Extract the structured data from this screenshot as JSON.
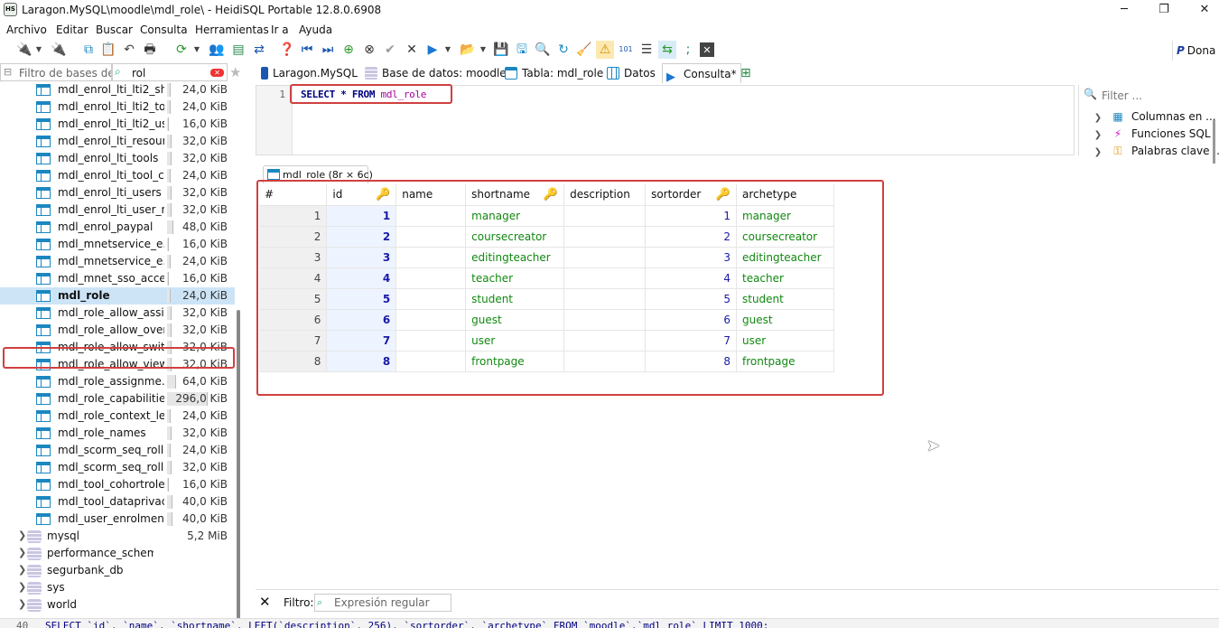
{
  "window": {
    "app_icon_text": "HS",
    "title": "Laragon.MySQL\\moodle\\mdl_role\\ - HeidiSQL Portable 12.8.0.6908",
    "minimize": "─",
    "maximize": "❐",
    "close": "✕"
  },
  "menu": [
    "Archivo",
    "Editar",
    "Buscar",
    "Consulta",
    "Herramientas",
    "Ir a",
    "Ayuda"
  ],
  "toolbar": {
    "donate_label": "Dona"
  },
  "sidebar": {
    "db_filter_placeholder": "Filtro de bases de d",
    "table_filter_value": "rol",
    "tables": [
      {
        "name": "mdl_enrol_lti_lti2_sh...",
        "size": "24,0 KiB",
        "fill": 0.08
      },
      {
        "name": "mdl_enrol_lti_lti2_to...",
        "size": "24,0 KiB",
        "fill": 0.08
      },
      {
        "name": "mdl_enrol_lti_lti2_us...",
        "size": "16,0 KiB",
        "fill": 0.05
      },
      {
        "name": "mdl_enrol_lti_resour...",
        "size": "32,0 KiB",
        "fill": 0.11
      },
      {
        "name": "mdl_enrol_lti_tools",
        "size": "32,0 KiB",
        "fill": 0.11
      },
      {
        "name": "mdl_enrol_lti_tool_c...",
        "size": "24,0 KiB",
        "fill": 0.08
      },
      {
        "name": "mdl_enrol_lti_users",
        "size": "32,0 KiB",
        "fill": 0.11
      },
      {
        "name": "mdl_enrol_lti_user_r...",
        "size": "32,0 KiB",
        "fill": 0.11
      },
      {
        "name": "mdl_enrol_paypal",
        "size": "48,0 KiB",
        "fill": 0.16
      },
      {
        "name": "mdl_mnetservice_e...",
        "size": "16,0 KiB",
        "fill": 0.05
      },
      {
        "name": "mdl_mnetservice_e...",
        "size": "24,0 KiB",
        "fill": 0.08
      },
      {
        "name": "mdl_mnet_sso_acce...",
        "size": "16,0 KiB",
        "fill": 0.05
      },
      {
        "name": "mdl_role",
        "size": "24,0 KiB",
        "fill": 0.08,
        "selected": true
      },
      {
        "name": "mdl_role_allow_assi...",
        "size": "32,0 KiB",
        "fill": 0.11
      },
      {
        "name": "mdl_role_allow_over...",
        "size": "32,0 KiB",
        "fill": 0.11
      },
      {
        "name": "mdl_role_allow_swit...",
        "size": "32,0 KiB",
        "fill": 0.11
      },
      {
        "name": "mdl_role_allow_view",
        "size": "32,0 KiB",
        "fill": 0.11
      },
      {
        "name": "mdl_role_assignme...",
        "size": "64,0 KiB",
        "fill": 0.22
      },
      {
        "name": "mdl_role_capabilities",
        "size": "296,0 KiB",
        "fill": 1.0
      },
      {
        "name": "mdl_role_context_le...",
        "size": "24,0 KiB",
        "fill": 0.08
      },
      {
        "name": "mdl_role_names",
        "size": "32,0 KiB",
        "fill": 0.11
      },
      {
        "name": "mdl_scorm_seq_roll...",
        "size": "24,0 KiB",
        "fill": 0.08
      },
      {
        "name": "mdl_scorm_seq_roll...",
        "size": "32,0 KiB",
        "fill": 0.11
      },
      {
        "name": "mdl_tool_cohortroles",
        "size": "16,0 KiB",
        "fill": 0.05
      },
      {
        "name": "mdl_tool_dataprivac...",
        "size": "40,0 KiB",
        "fill": 0.14
      },
      {
        "name": "mdl_user_enrolments",
        "size": "40,0 KiB",
        "fill": 0.14
      }
    ],
    "databases": [
      {
        "name": "mysql",
        "size": "5,2 MiB"
      },
      {
        "name": "performance_schema",
        "size": ""
      },
      {
        "name": "segurbank_db",
        "size": ""
      },
      {
        "name": "sys",
        "size": ""
      },
      {
        "name": "world",
        "size": ""
      }
    ]
  },
  "tabs": [
    {
      "label": "Laragon.MySQL"
    },
    {
      "label": "Base de datos: moodle"
    },
    {
      "label": "Tabla: mdl_role"
    },
    {
      "label": "Datos"
    },
    {
      "label": "Consulta*"
    }
  ],
  "editor": {
    "line_number": "1",
    "sql_select": "SELECT",
    "sql_star": " * ",
    "sql_from": "FROM",
    "sql_table": " mdl_role"
  },
  "help_panel": {
    "filter_placeholder": "Filter ...",
    "items": [
      "Columnas en ...",
      "Funciones SQL",
      "Palabras clave ..."
    ]
  },
  "result": {
    "tab_label": "mdl_role (8r × 6c)",
    "columns": [
      "#",
      "id",
      "name",
      "shortname",
      "description",
      "sortorder",
      "archetype"
    ],
    "rows": [
      {
        "n": "1",
        "id": "1",
        "name": "",
        "shortname": "manager",
        "description": "",
        "sortorder": "1",
        "archetype": "manager"
      },
      {
        "n": "2",
        "id": "2",
        "name": "",
        "shortname": "coursecreator",
        "description": "",
        "sortorder": "2",
        "archetype": "coursecreator"
      },
      {
        "n": "3",
        "id": "3",
        "name": "",
        "shortname": "editingteacher",
        "description": "",
        "sortorder": "3",
        "archetype": "editingteacher"
      },
      {
        "n": "4",
        "id": "4",
        "name": "",
        "shortname": "teacher",
        "description": "",
        "sortorder": "4",
        "archetype": "teacher"
      },
      {
        "n": "5",
        "id": "5",
        "name": "",
        "shortname": "student",
        "description": "",
        "sortorder": "5",
        "archetype": "student"
      },
      {
        "n": "6",
        "id": "6",
        "name": "",
        "shortname": "guest",
        "description": "",
        "sortorder": "6",
        "archetype": "guest"
      },
      {
        "n": "7",
        "id": "7",
        "name": "",
        "shortname": "user",
        "description": "",
        "sortorder": "7",
        "archetype": "user"
      },
      {
        "n": "8",
        "id": "8",
        "name": "",
        "shortname": "frontpage",
        "description": "",
        "sortorder": "8",
        "archetype": "frontpage"
      }
    ]
  },
  "filter_bar": {
    "label": "Filtro:",
    "placeholder": "Expresión regular"
  },
  "status": {
    "line": "40",
    "sql": "SELECT `id`, `name`, `shortname`, LEFT(`description`, 256), `sortorder`, `archetype` FROM `moodle`.`mdl_role` LIMIT 1000;"
  },
  "colors": {
    "highlight_outline": "#d04040",
    "number_text": "#1a1aa8",
    "string_text": "#118811",
    "sql_keyword": "#000080",
    "sql_table": "#aa0099"
  }
}
